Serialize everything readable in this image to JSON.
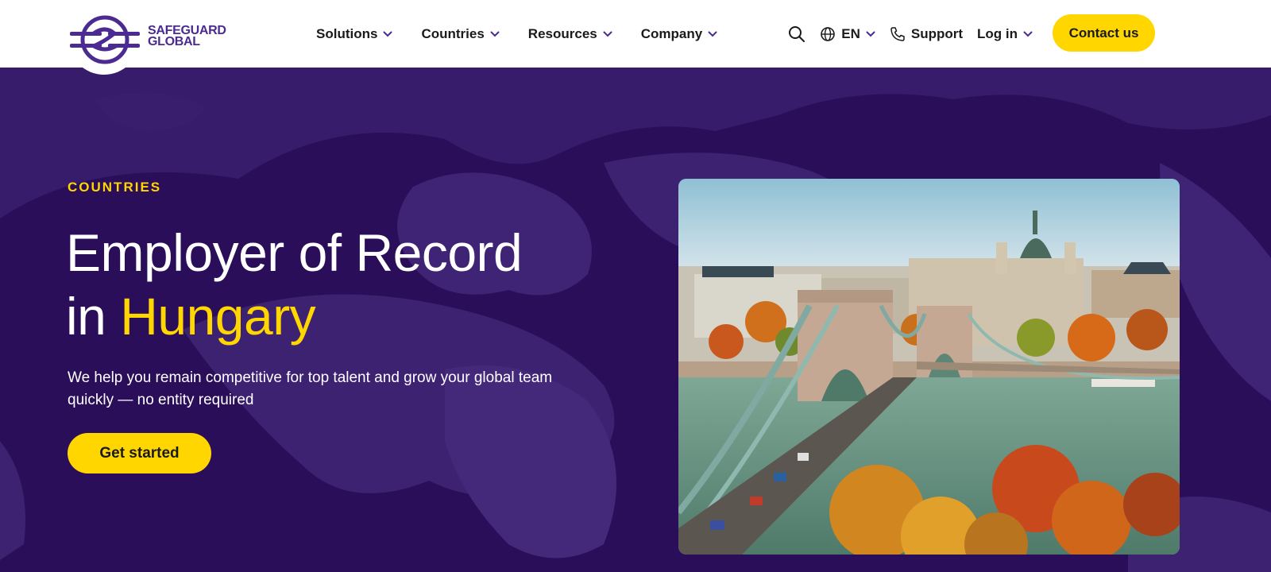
{
  "brand": {
    "name_line1": "SAFEGUARD",
    "name_line2": "GLOBAL",
    "logo_icon": "safeguard-logo-icon"
  },
  "nav": {
    "items": [
      {
        "label": "Solutions"
      },
      {
        "label": "Countries"
      },
      {
        "label": "Resources"
      },
      {
        "label": "Company"
      }
    ]
  },
  "utility": {
    "search_icon": "search-icon",
    "language": "EN",
    "support": "Support",
    "login": "Log in",
    "contact": "Contact us"
  },
  "hero": {
    "eyebrow": "COUNTRIES",
    "title_line1": "Employer of Record",
    "title_in": "in",
    "title_country": "Hungary",
    "subtext": "We help you remain competitive for top talent and grow your global team quickly — no entity required",
    "cta": "Get started",
    "image_subject": "Széchenyi Chain Bridge, Budapest"
  },
  "colors": {
    "brand_purple": "#4b2a91",
    "hero_bg": "#2a0e5a",
    "accent_yellow": "#ffd600",
    "text_white": "#ffffff"
  }
}
